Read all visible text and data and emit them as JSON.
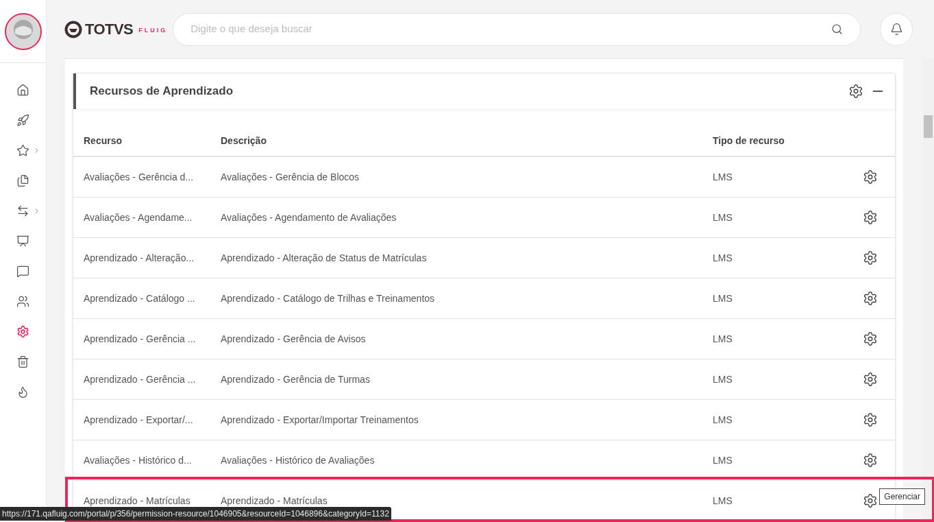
{
  "header": {
    "logo_text": "TOTVS",
    "logo_sub": "FLUIG",
    "search": {
      "placeholder": "Digite o que deseja buscar"
    }
  },
  "sidebar": {
    "items": [
      {
        "kind": "home",
        "selected": false,
        "submenu": false
      },
      {
        "kind": "rocket",
        "selected": false,
        "submenu": false
      },
      {
        "kind": "star",
        "selected": false,
        "submenu": true
      },
      {
        "kind": "documents",
        "selected": false,
        "submenu": false
      },
      {
        "kind": "arrows",
        "selected": false,
        "submenu": true
      },
      {
        "kind": "presentation",
        "selected": false,
        "submenu": false
      },
      {
        "kind": "chat",
        "selected": false,
        "submenu": false
      },
      {
        "kind": "users",
        "selected": false,
        "submenu": false
      },
      {
        "kind": "gear",
        "selected": true,
        "submenu": false
      },
      {
        "kind": "trash",
        "selected": false,
        "submenu": false
      },
      {
        "kind": "flame",
        "selected": false,
        "submenu": false
      }
    ]
  },
  "panel": {
    "title": "Recursos de Aprendizado",
    "table": {
      "columns": [
        "Recurso",
        "Descrição",
        "Tipo de recurso"
      ],
      "rows": [
        {
          "resource": "Avaliações - Gerência d...",
          "description": "Avaliações - Gerência de Blocos",
          "type": "LMS",
          "highlighted": false
        },
        {
          "resource": "Avaliações - Agendame...",
          "description": "Avaliações - Agendamento de Avaliações",
          "type": "LMS",
          "highlighted": false
        },
        {
          "resource": "Aprendizado - Alteração...",
          "description": "Aprendizado - Alteração de Status de Matrículas",
          "type": "LMS",
          "highlighted": false
        },
        {
          "resource": "Aprendizado - Catálogo ...",
          "description": "Aprendizado - Catálogo de Trilhas e Treinamentos",
          "type": "LMS",
          "highlighted": false
        },
        {
          "resource": "Aprendizado - Gerência ...",
          "description": "Aprendizado - Gerência de Avisos",
          "type": "LMS",
          "highlighted": false
        },
        {
          "resource": "Aprendizado - Gerência ...",
          "description": "Aprendizado - Gerência de Turmas",
          "type": "LMS",
          "highlighted": false
        },
        {
          "resource": "Aprendizado - Exportar/...",
          "description": "Aprendizado - Exportar/Importar Treinamentos",
          "type": "LMS",
          "highlighted": false
        },
        {
          "resource": "Avaliações - Histórico d...",
          "description": "Avaliações - Histórico de Avaliações",
          "type": "LMS",
          "highlighted": false
        },
        {
          "resource": "Aprendizado - Matrículas",
          "description": "Aprendizado - Matrículas",
          "type": "LMS",
          "highlighted": true
        }
      ]
    }
  },
  "tooltip": "Gerenciar",
  "status_url": "https://171.qafluig.com/portal/p/356/permission-resource/1046905&resourceId=1046896&categoryId=1132"
}
